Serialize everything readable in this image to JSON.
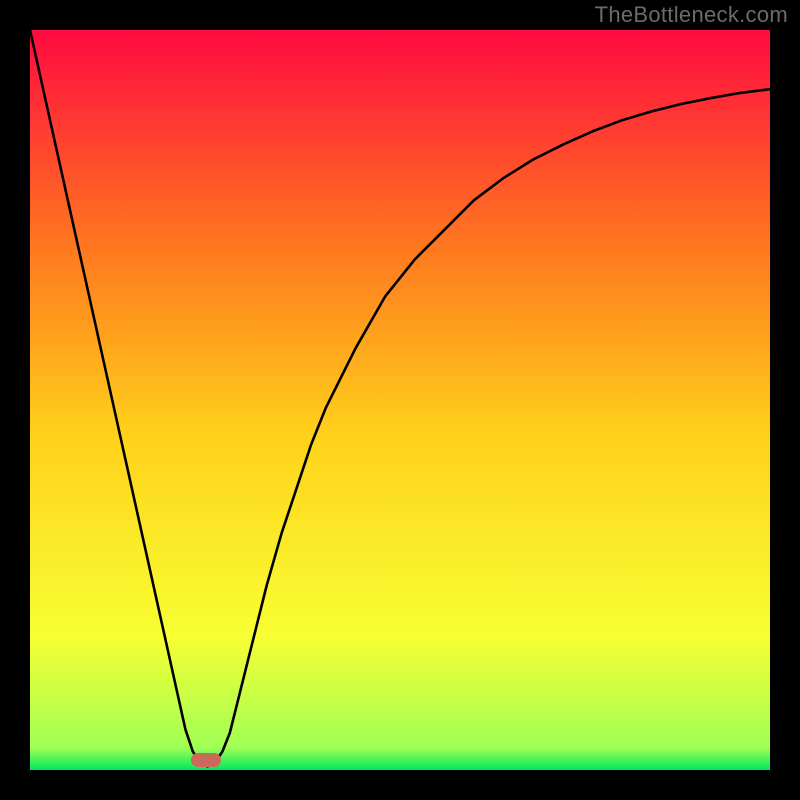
{
  "watermark": "TheBottleneck.com",
  "colors": {
    "top": "#ff0a3f",
    "q1": "#ff7a1f",
    "mid": "#ffd21a",
    "q3": "#f7ff33",
    "bottom": "#00e85e",
    "curve": "#000000",
    "marker": "#cb6a58",
    "frame": "#000000"
  },
  "chart_data": {
    "type": "line",
    "title": "",
    "xlabel": "",
    "ylabel": "",
    "xlim": [
      0,
      100
    ],
    "ylim": [
      0,
      100
    ],
    "x": [
      0,
      2,
      4,
      6,
      8,
      10,
      12,
      14,
      16,
      18,
      20,
      21,
      22,
      23,
      24,
      25,
      26,
      27,
      28,
      30,
      32,
      34,
      36,
      38,
      40,
      44,
      48,
      52,
      56,
      60,
      64,
      68,
      72,
      76,
      80,
      84,
      88,
      92,
      96,
      100
    ],
    "values": [
      100,
      91,
      82,
      73,
      64,
      55,
      46,
      37,
      28,
      19,
      10,
      5.5,
      2.5,
      1.0,
      0.5,
      1.0,
      2.5,
      5.0,
      9.0,
      17,
      25,
      32,
      38,
      44,
      49,
      57,
      64,
      69,
      73,
      77,
      80,
      82.5,
      84.5,
      86.3,
      87.8,
      89.0,
      90.0,
      90.8,
      91.5,
      92
    ],
    "marker": {
      "x_pct": 23.8,
      "y_pct_from_bottom": 1.3
    },
    "grid": false,
    "legend": false
  }
}
